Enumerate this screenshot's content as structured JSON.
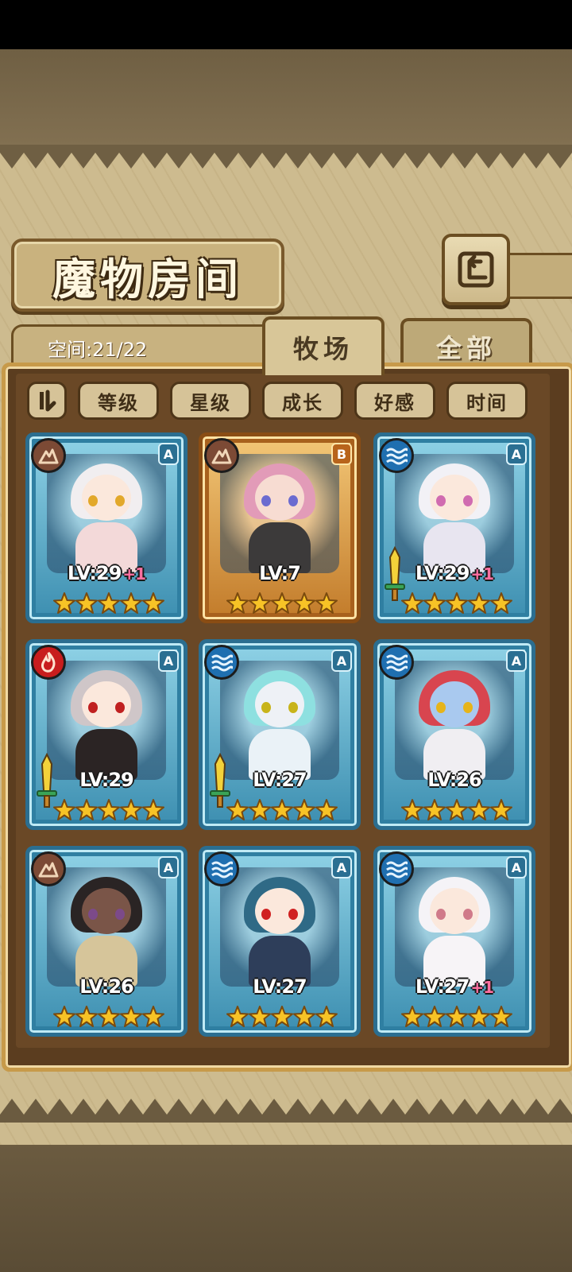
{
  "header": {
    "title": "魔物房间"
  },
  "info": {
    "space_label": "空间:21/22"
  },
  "tabs": [
    {
      "label": "牧场",
      "active": true
    },
    {
      "label": "全部",
      "active": false
    }
  ],
  "sort_buttons": [
    {
      "label": "等级"
    },
    {
      "label": "星级"
    },
    {
      "label": "成长"
    },
    {
      "label": "好感"
    },
    {
      "label": "时间"
    }
  ],
  "monsters": [
    {
      "level": "LV:29",
      "bonus": "+1",
      "rank": "A",
      "element": "earth",
      "stars": 5,
      "weapon": false,
      "frame": "blue"
    },
    {
      "level": "LV:7",
      "bonus": "",
      "rank": "B",
      "element": "earth",
      "stars": 5,
      "weapon": false,
      "frame": "gold"
    },
    {
      "level": "LV:29",
      "bonus": "+1",
      "rank": "A",
      "element": "water",
      "stars": 5,
      "weapon": true,
      "frame": "blue"
    },
    {
      "level": "LV:29",
      "bonus": "",
      "rank": "A",
      "element": "fire",
      "stars": 5,
      "weapon": true,
      "frame": "blue"
    },
    {
      "level": "LV:27",
      "bonus": "",
      "rank": "A",
      "element": "water",
      "stars": 5,
      "weapon": true,
      "frame": "blue"
    },
    {
      "level": "LV:26",
      "bonus": "",
      "rank": "A",
      "element": "water",
      "stars": 5,
      "weapon": false,
      "frame": "blue"
    },
    {
      "level": "LV:26",
      "bonus": "",
      "rank": "A",
      "element": "earth",
      "stars": 5,
      "weapon": false,
      "frame": "blue"
    },
    {
      "level": "LV:27",
      "bonus": "",
      "rank": "A",
      "element": "water",
      "stars": 5,
      "weapon": false,
      "frame": "blue"
    },
    {
      "level": "LV:27",
      "bonus": "+1",
      "rank": "A",
      "element": "water",
      "stars": 5,
      "weapon": false,
      "frame": "blue"
    }
  ],
  "colors": {
    "star": "#f7c326",
    "frame_blue": "#2b6e90",
    "frame_gold": "#8a4d14",
    "plus": "#ff6fa0"
  },
  "icons": {
    "back": "return-arrow-icon",
    "sort_toggle": "sort-order-icon",
    "earth": "earth-element-icon",
    "water": "water-element-icon",
    "fire": "fire-element-icon",
    "weapon": "sword-icon",
    "star": "star-icon"
  }
}
